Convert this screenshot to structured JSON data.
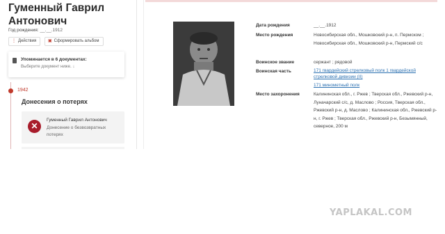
{
  "person": {
    "name": "Гуменный Гаврил Антонович",
    "birth_label": "Год рождения:",
    "birth_value": "__.__.1912"
  },
  "actions": {
    "actions_label": "Действия",
    "album_label": "Сформировать альбом"
  },
  "mentions": {
    "title": "Упоминается в 6 документах:",
    "subtitle": "Выберите документ ниже. ↓"
  },
  "timeline": {
    "year": "1942",
    "section_title": "Донесения о потерях",
    "record": {
      "name": "Гуменный Гаврил Антонович",
      "type": "Донесение о безвозвратных потерях"
    }
  },
  "details": {
    "birth_date": {
      "label": "Дата рождения",
      "value": "__.__.1912"
    },
    "birth_place": {
      "label": "Место рождения",
      "value": "Новосибирская обл., Мошковский р-н, п. Пермском ; Новосибирская обл., Мошковский р-н, Пермский с/с"
    },
    "rank": {
      "label": "Воинское звание",
      "value": "сержант ; рядовой"
    },
    "unit": {
      "label": "Воинская часть",
      "link1": "171 гвардейский стрелковый полк 1 гвардейской стрелковой дивизии (II)",
      "link2": "171 минометный полк"
    },
    "burial": {
      "label": "Место захоронения",
      "value": "Калининская обл., г. Ржев ; Тверская обл., Ржевский р-н, Луначарский с/с, д. Маслово ; Россия, Тверская обл., Ржевский р-н, д. Маслово ; Калининская обл., Ржевский р-н, г. Ржев ; Тверская обл., Ржевский р-н, Безымянный, северное, 200 м"
    }
  },
  "watermark": "YAPLAKAL.COM",
  "colors": {
    "accent": "#c0392b",
    "link": "#2a6fb0",
    "danger_icon": "#a81c2b"
  },
  "icons": [
    "dots-icon",
    "album-icon",
    "document-icon",
    "close-icon"
  ]
}
